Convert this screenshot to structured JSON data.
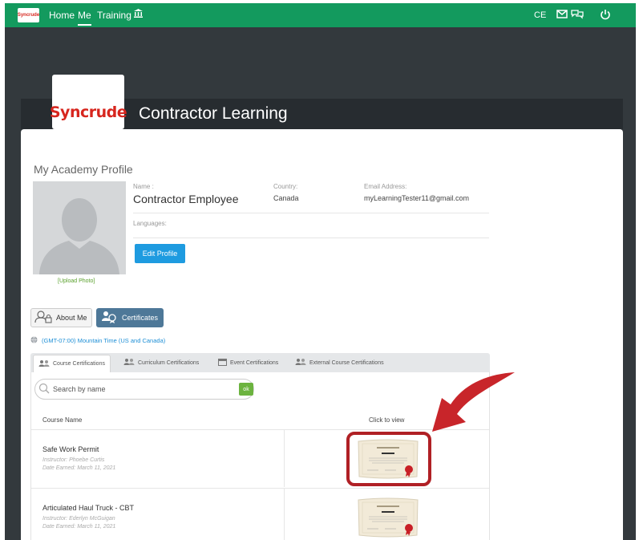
{
  "topnav": {
    "logo_text": "Syncrude",
    "items": [
      {
        "label": "Home"
      },
      {
        "label": "Me"
      },
      {
        "label": "Training"
      }
    ],
    "ce_label": "CE"
  },
  "header": {
    "logo_text": "Syncrude",
    "title": "Contractor Learning"
  },
  "profile": {
    "section_title": "My Academy Profile",
    "name_label": "Name :",
    "name_value": "Contractor Employee",
    "country_label": "Country:",
    "country_value": "Canada",
    "email_label": "Email Address:",
    "email_value": "myLearningTester11@gmail.com",
    "languages_label": "Languages:",
    "edit_button": "Edit Profile",
    "upload_photo": "[Upload Photo]"
  },
  "tabs": {
    "about_me": "About Me",
    "certificates": "Certificates"
  },
  "timezone": "(GMT-07:00) Mountain Time (US and Canada)",
  "cert_tabs": [
    {
      "label": "Course Certifications"
    },
    {
      "label": "Curriculum Certifications"
    },
    {
      "label": "Event Certifications"
    },
    {
      "label": "External Course Certifications"
    }
  ],
  "search": {
    "placeholder": "Search by name",
    "ok_label": "ok"
  },
  "table": {
    "col_course": "Course Name",
    "col_view": "Click to view",
    "rows": [
      {
        "name": "Safe Work Permit",
        "instructor": "Instructor: Phoebe Curtis",
        "earned": "Date Earned: March 11, 2021"
      },
      {
        "name": "Articulated Haul Truck - CBT",
        "instructor": "Instructor: Ederlyn McGuigan",
        "earned": "Date Earned: March 11, 2021"
      }
    ],
    "cert_title": "Certificate of Completion",
    "cert_name": "John Doe"
  },
  "colors": {
    "nav_green": "#139a5e",
    "brand_red": "#d7261e",
    "highlight_red": "#b02025",
    "edit_blue": "#1e9be0",
    "cert_tab_blue": "#4e7898"
  }
}
